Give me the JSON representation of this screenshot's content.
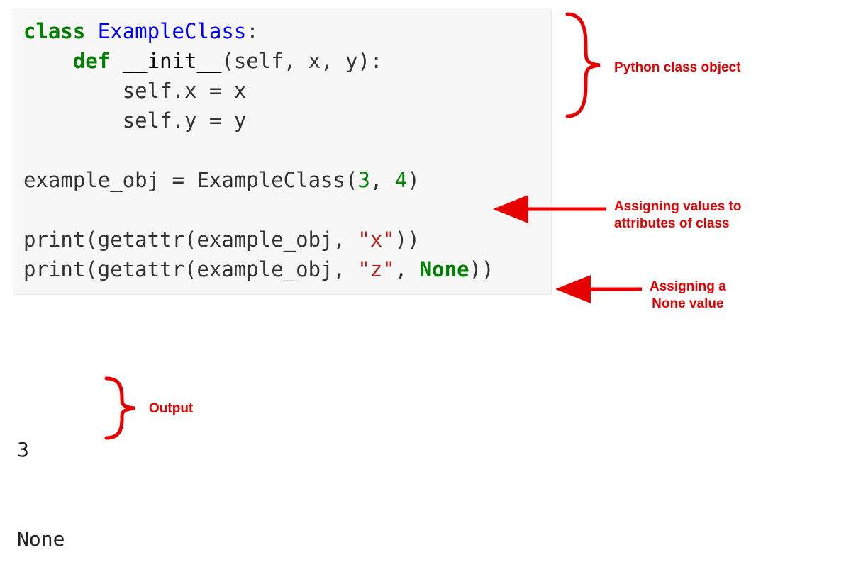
{
  "code": {
    "l1_kw": "class",
    "l1_cls": "ExampleClass",
    "l1_colon": ":",
    "l2_kw": "def",
    "l2_name": "__init__",
    "l2_sig": "(self, x, y):",
    "l3": "self.x = x",
    "l4": "self.y = y",
    "l5_left": "example_obj = ",
    "l5_cls": "ExampleClass",
    "l5_open": "(",
    "l5_n1": "3",
    "l5_comma": ", ",
    "l5_n2": "4",
    "l5_close": ")",
    "l6_a": "print(getattr(example_obj, ",
    "l6_str": "\"x\"",
    "l6_b": "))",
    "l7_a": "print(getattr(example_obj, ",
    "l7_str": "\"z\"",
    "l7_b": ", ",
    "l7_none": "None",
    "l7_c": "))"
  },
  "output": {
    "line1": "3",
    "line2": "None"
  },
  "annotations": {
    "class_obj": "Python class object",
    "assign_attrs_l1": "Assigning values to",
    "assign_attrs_l2": "attributes of class",
    "assign_none_l1": "Assigning a",
    "assign_none_l2": "None value",
    "output": "Output"
  }
}
